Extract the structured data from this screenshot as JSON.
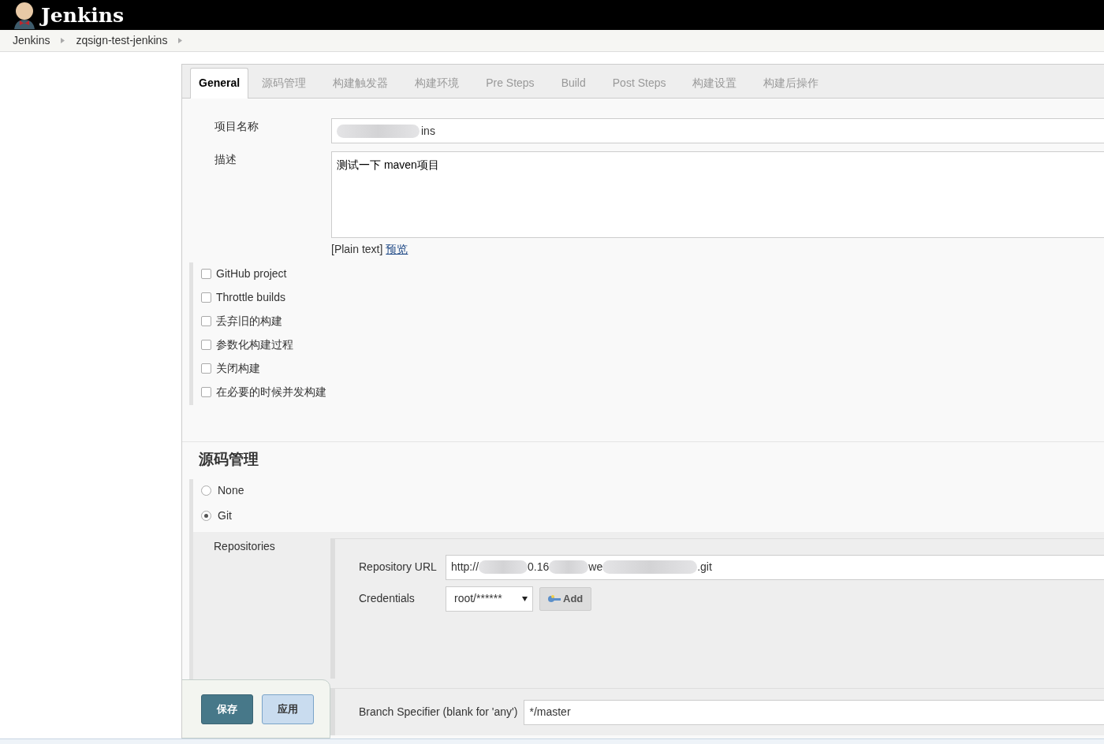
{
  "header": {
    "title": "Jenkins"
  },
  "breadcrumbs": [
    {
      "label": "Jenkins"
    },
    {
      "label": "zqsign-test-jenkins"
    }
  ],
  "tabs": [
    {
      "label": "General",
      "selected": true
    },
    {
      "label": "源码管理",
      "selected": false
    },
    {
      "label": "构建触发器",
      "selected": false
    },
    {
      "label": "构建环境",
      "selected": false
    },
    {
      "label": "Pre Steps",
      "selected": false
    },
    {
      "label": "Build",
      "selected": false
    },
    {
      "label": "Post Steps",
      "selected": false
    },
    {
      "label": "构建设置",
      "selected": false
    },
    {
      "label": "构建后操作",
      "selected": false
    }
  ],
  "general": {
    "name_field": {
      "label": "项目名称",
      "value": "ins"
    },
    "description_field": {
      "label": "描述",
      "value": "测试一下 maven项目"
    },
    "format_note": "[Plain text]",
    "preview_link": "预览",
    "options": [
      {
        "label": "GitHub project",
        "checked": false
      },
      {
        "label": "Throttle builds",
        "checked": false
      },
      {
        "label": "丢弃旧的构建",
        "checked": false
      },
      {
        "label": "参数化构建过程",
        "checked": false
      },
      {
        "label": "关闭构建",
        "checked": false
      },
      {
        "label": "在必要的时候并发构建",
        "checked": false
      }
    ]
  },
  "scm": {
    "title": "源码管理",
    "choices": [
      {
        "label": "None",
        "selected": false
      },
      {
        "label": "Git",
        "selected": true
      }
    ],
    "repositories_label": "Repositories",
    "repository_url": {
      "label": "Repository URL",
      "visible_parts": [
        "http://",
        "0.16",
        "we",
        ".git"
      ]
    },
    "credentials": {
      "label": "Credentials",
      "value": "root/******"
    },
    "add_button": "Add",
    "branch": {
      "label": "Branch Specifier (blank for 'any')",
      "value": "*/master"
    }
  },
  "actions": [
    {
      "label": "保存",
      "kind": "primary"
    },
    {
      "label": "应用",
      "kind": "secondary"
    }
  ]
}
